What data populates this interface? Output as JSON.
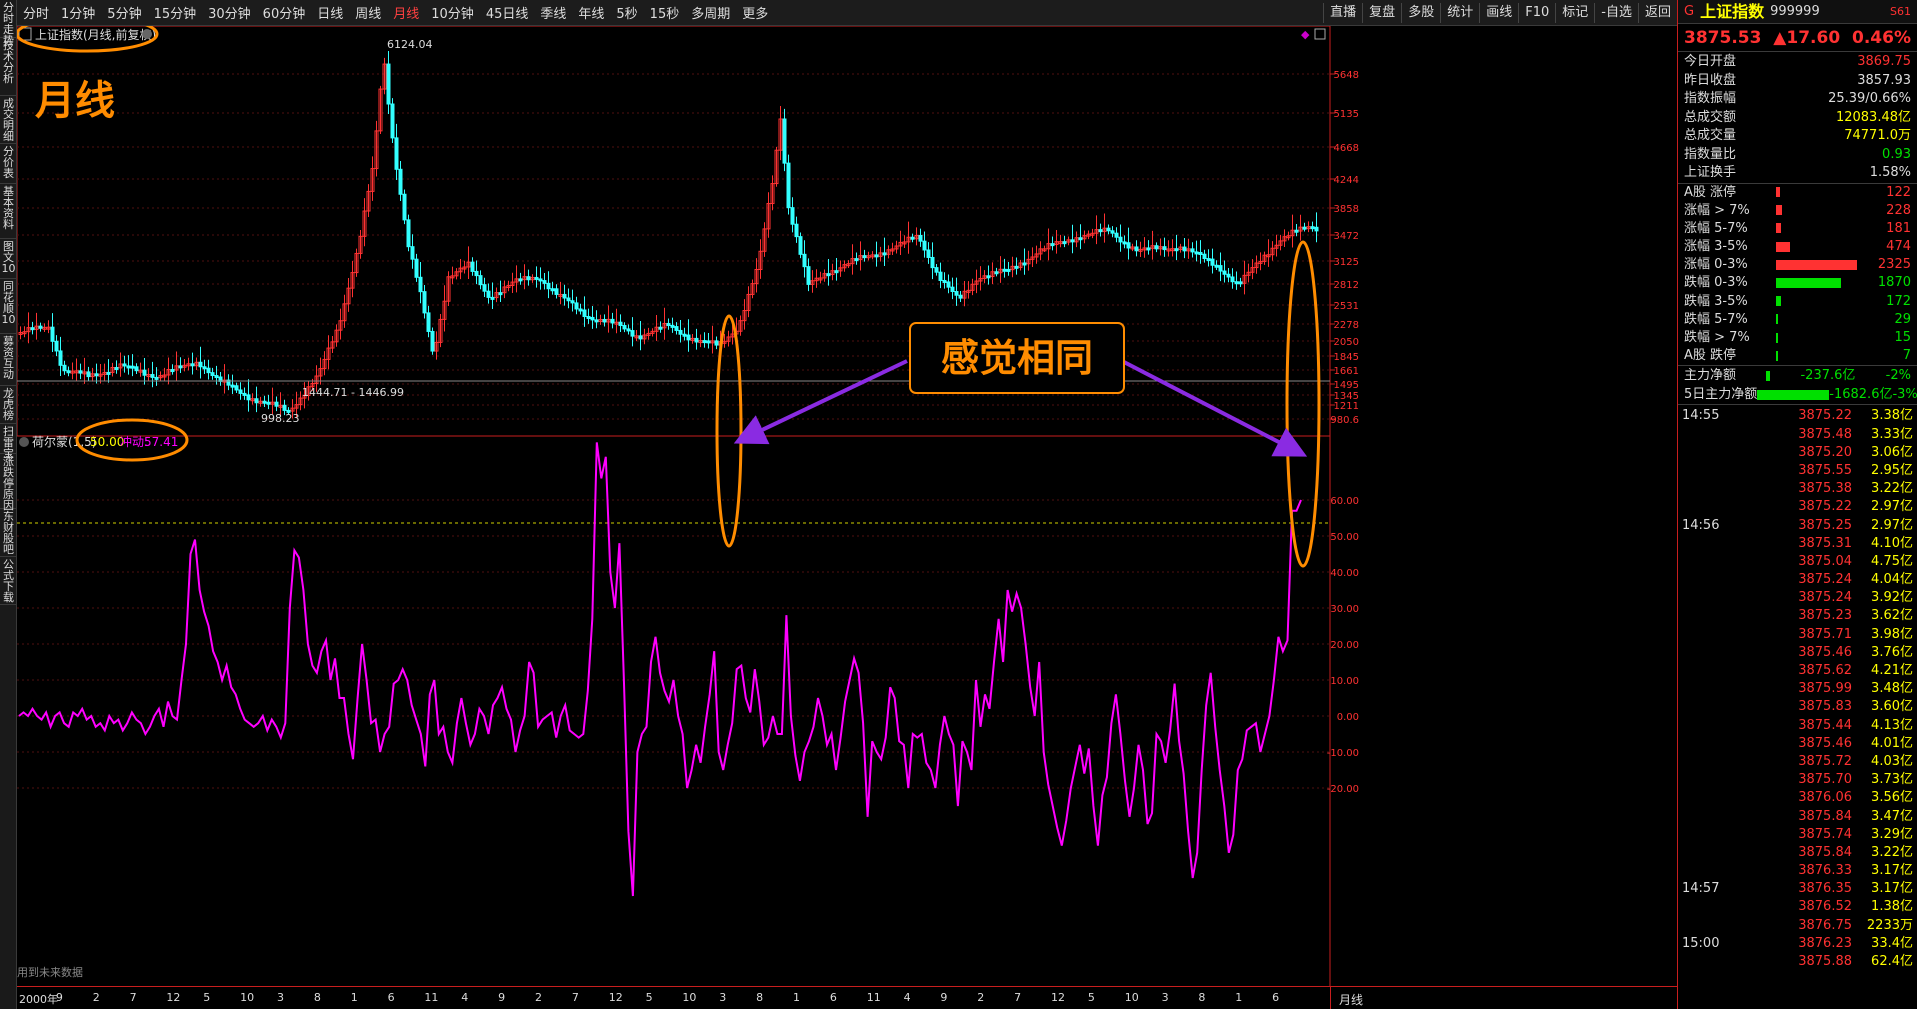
{
  "left_tabs": [
    "分时走势",
    "技术分析",
    "成交明细",
    "分价表",
    "基本资料",
    "图文10",
    "同花顺10",
    "募资互动",
    "龙虎榜",
    "扫雷宝",
    "涨跌停原因",
    "东财股吧",
    "公式下载"
  ],
  "toolbar": {
    "periods": [
      "分时",
      "1分钟",
      "5分钟",
      "15分钟",
      "30分钟",
      "60分钟",
      "日线",
      "周线",
      "月线",
      "10分钟",
      "45日线",
      "季线",
      "年线",
      "5秒",
      "15秒",
      "多周期",
      "更多"
    ],
    "active": "月线",
    "right_buttons": [
      "直播",
      "复盘",
      "多股",
      "统计",
      "画线",
      "F10",
      "标记",
      "-自选",
      "返回"
    ]
  },
  "chart": {
    "title": "上证指数(月线,前复权)",
    "overlay_label": "月线",
    "peak_label": "6124.04",
    "trough_label": "998.23",
    "range_label": "1444.71 - 1446.99",
    "price_axis": [
      "5648",
      "5135",
      "4668",
      "4244",
      "3858",
      "3472",
      "3125",
      "2812",
      "2531",
      "2278",
      "2050",
      "1845",
      "1661",
      "1495",
      "1345",
      "1211",
      "980.6"
    ],
    "indicator": {
      "name": "荷尔蒙(1,5)",
      "level_value": "50.00",
      "impulse_label": "冲动:",
      "impulse_value": "57.41"
    },
    "indicator_axis": [
      "60.00",
      "50.00",
      "40.00",
      "30.00",
      "20.00",
      "10.00",
      "0.00",
      "-10.00",
      "-20.00"
    ],
    "annotation": "感觉相同",
    "future_data_note": "用到未来数据",
    "period_label": "月线",
    "date_axis": [
      "2000年",
      "9",
      "2",
      "7",
      "12",
      "5",
      "10",
      "3",
      "8",
      "1",
      "6",
      "11",
      "4",
      "9",
      "2",
      "7",
      "12",
      "5",
      "10",
      "3",
      "8",
      "1",
      "6",
      "11",
      "4",
      "9",
      "2",
      "7",
      "12",
      "5",
      "10",
      "3",
      "8",
      "1",
      "6"
    ]
  },
  "chart_data": {
    "type": "line",
    "title": "上证指数(月线,前复权)",
    "series": [
      {
        "name": "荷尔蒙(1,5)",
        "values": [
          0,
          1,
          0,
          2,
          0,
          -1,
          1,
          -3,
          0,
          1,
          -2,
          -3,
          1,
          0,
          2,
          -1,
          0,
          -3,
          -2,
          -4,
          0,
          -2,
          -1,
          -4,
          -2,
          1,
          -1,
          -2,
          -5,
          -3,
          0,
          2,
          -3,
          4,
          0,
          -1,
          10,
          20,
          45,
          49,
          35,
          29,
          25,
          18,
          15,
          10,
          14,
          8,
          6,
          2,
          -1,
          -2,
          -3,
          -2,
          0,
          -4,
          -1,
          -3,
          -6,
          -2,
          30,
          46,
          44,
          35,
          20,
          14,
          12,
          18,
          21,
          10,
          16,
          5,
          5,
          -5,
          -12,
          5,
          20,
          10,
          -2,
          -1,
          -10,
          -5,
          -3,
          9,
          10,
          13,
          10,
          3,
          -1,
          -5,
          -14,
          6,
          10,
          -5,
          -3,
          -10,
          -13,
          -2,
          5,
          -2,
          -8,
          -5,
          2,
          0,
          -5,
          3,
          5,
          8,
          2,
          -1,
          -10,
          -4,
          0,
          15,
          12,
          -3,
          -1,
          0,
          1,
          -6,
          0,
          3,
          -4,
          -5,
          -6,
          -5,
          7,
          27,
          76,
          66,
          72,
          40,
          30,
          48,
          10,
          -32,
          -50,
          -10,
          -5,
          -3,
          15,
          22,
          12,
          7,
          4,
          10,
          0,
          -5,
          -20,
          -15,
          -8,
          -13,
          -3,
          6,
          18,
          -10,
          -15,
          -8,
          -2,
          13,
          14,
          5,
          1,
          13,
          4,
          -8,
          -6,
          0,
          -5,
          -5,
          28,
          0,
          -11,
          -18,
          -10,
          -7,
          -3,
          5,
          0,
          -8,
          -5,
          -15,
          -6,
          4,
          10,
          16,
          12,
          -2,
          -28,
          -7,
          -10,
          -12,
          -6,
          8,
          5,
          -7,
          -8,
          -20,
          -5,
          -6,
          -5,
          -13,
          -15,
          -20,
          -8,
          0,
          -5,
          -8,
          -25,
          -7,
          -10,
          -15,
          10,
          -3,
          6,
          2,
          15,
          27,
          15,
          35,
          29,
          34,
          30,
          20,
          8,
          0,
          15,
          -10,
          -19,
          -25,
          -31,
          -36,
          -29,
          -20,
          -14,
          -8,
          -16,
          -9,
          -25,
          -36,
          -22,
          -17,
          -2,
          6,
          -5,
          -18,
          -28,
          -20,
          -8,
          -15,
          -30,
          -27,
          -5,
          -7,
          -13,
          -4,
          9,
          -7,
          -16,
          -32,
          -45,
          -38,
          -15,
          3,
          12,
          -3,
          -15,
          -25,
          -38,
          -33,
          -15,
          -12,
          -4,
          -3,
          -2,
          -10,
          -5,
          0,
          10,
          22,
          18,
          21,
          57,
          57,
          60
        ]
      }
    ],
    "ylim": [
      -25,
      75
    ],
    "grid": true
  },
  "right_panel": {
    "header": {
      "market": "G",
      "name": "上证指数",
      "code": "999999",
      "extra": "S61"
    },
    "quote": {
      "price": "3875.53",
      "change": "▲17.60",
      "pct": "0.46%"
    },
    "stats": [
      {
        "label": "今日开盘",
        "value": "3869.75",
        "color": "red"
      },
      {
        "label": "昨日收盘",
        "value": "3857.93",
        "color": "white"
      },
      {
        "label": "指数振幅",
        "value": "25.39/0.66%",
        "color": "white"
      },
      {
        "label": "总成交额",
        "value": "12083.48亿",
        "color": "yellow"
      },
      {
        "label": "总成交量",
        "value": "74771.0万",
        "color": "yellow"
      },
      {
        "label": "指数量比",
        "value": "0.93",
        "color": "green"
      },
      {
        "label": "上证换手",
        "value": "1.58%",
        "color": "white"
      }
    ],
    "breadth": [
      {
        "label": "A股 涨停",
        "value": "122",
        "bar": 0.04,
        "color": "red"
      },
      {
        "label": "涨幅 > 7%",
        "value": "228",
        "bar": 0.07,
        "color": "red"
      },
      {
        "label": "涨幅 5-7%",
        "value": "181",
        "bar": 0.06,
        "color": "red"
      },
      {
        "label": "涨幅 3-5%",
        "value": "474",
        "bar": 0.15,
        "color": "red"
      },
      {
        "label": "涨幅 0-3%",
        "value": "2325",
        "bar": 0.9,
        "color": "red"
      },
      {
        "label": "跌幅 0-3%",
        "value": "1870",
        "bar": 0.72,
        "color": "green"
      },
      {
        "label": "跌幅 3-5%",
        "value": "172",
        "bar": 0.06,
        "color": "green"
      },
      {
        "label": "跌幅 5-7%",
        "value": "29",
        "bar": 0.01,
        "color": "green"
      },
      {
        "label": "跌幅 > 7%",
        "value": "15",
        "bar": 0.01,
        "color": "green"
      },
      {
        "label": "A股 跌停",
        "value": "7",
        "bar": 0.005,
        "color": "green"
      }
    ],
    "flows": [
      {
        "label": "主力净额",
        "value": "-237.6亿",
        "pct": "-2%",
        "bar": 0.02
      },
      {
        "label": "5日主力净额",
        "value": "-1682.6亿",
        "pct": "-3%",
        "bar": 0.45
      }
    ],
    "ticks": [
      {
        "time": "14:55",
        "price": "3875.22",
        "vol": "3.38亿"
      },
      {
        "time": "",
        "price": "3875.48",
        "vol": "3.33亿"
      },
      {
        "time": "",
        "price": "3875.20",
        "vol": "3.06亿"
      },
      {
        "time": "",
        "price": "3875.55",
        "vol": "2.95亿"
      },
      {
        "time": "",
        "price": "3875.38",
        "vol": "3.22亿"
      },
      {
        "time": "",
        "price": "3875.22",
        "vol": "2.97亿"
      },
      {
        "time": "14:56",
        "price": "3875.25",
        "vol": "2.97亿"
      },
      {
        "time": "",
        "price": "3875.31",
        "vol": "4.10亿"
      },
      {
        "time": "",
        "price": "3875.04",
        "vol": "4.75亿"
      },
      {
        "time": "",
        "price": "3875.24",
        "vol": "4.04亿"
      },
      {
        "time": "",
        "price": "3875.24",
        "vol": "3.92亿"
      },
      {
        "time": "",
        "price": "3875.23",
        "vol": "3.62亿"
      },
      {
        "time": "",
        "price": "3875.71",
        "vol": "3.98亿"
      },
      {
        "time": "",
        "price": "3875.46",
        "vol": "3.76亿"
      },
      {
        "time": "",
        "price": "3875.62",
        "vol": "4.21亿"
      },
      {
        "time": "",
        "price": "3875.99",
        "vol": "3.48亿"
      },
      {
        "time": "",
        "price": "3875.83",
        "vol": "3.60亿"
      },
      {
        "time": "",
        "price": "3875.44",
        "vol": "4.13亿"
      },
      {
        "time": "",
        "price": "3875.46",
        "vol": "4.01亿"
      },
      {
        "time": "",
        "price": "3875.72",
        "vol": "4.03亿"
      },
      {
        "time": "",
        "price": "3875.70",
        "vol": "3.73亿"
      },
      {
        "time": "",
        "price": "3876.06",
        "vol": "3.56亿"
      },
      {
        "time": "",
        "price": "3875.84",
        "vol": "3.47亿"
      },
      {
        "time": "",
        "price": "3875.74",
        "vol": "3.29亿"
      },
      {
        "time": "",
        "price": "3875.84",
        "vol": "3.22亿"
      },
      {
        "time": "",
        "price": "3876.33",
        "vol": "3.17亿"
      },
      {
        "time": "14:57",
        "price": "3876.35",
        "vol": "3.17亿"
      },
      {
        "time": "",
        "price": "3876.52",
        "vol": "1.38亿"
      },
      {
        "time": "",
        "price": "3876.75",
        "vol": "2233万"
      },
      {
        "time": "15:00",
        "price": "3876.23",
        "vol": "33.4亿"
      },
      {
        "time": "",
        "price": "3875.88",
        "vol": "62.4亿"
      }
    ]
  },
  "colors": {
    "up": "#ff3232",
    "down": "#33ffff",
    "indicator": "#ff00ff",
    "annotation": "#ff8c00",
    "arrow": "#8a2be2"
  }
}
